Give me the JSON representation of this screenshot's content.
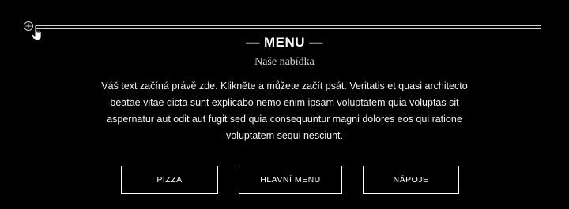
{
  "section": {
    "heading": "— MENU —",
    "subheading": "Naše nabídka",
    "body": "Váš text začíná právě zde. Klikněte a můžete začít psát. Veritatis et quasi architecto beatae vitae dicta sunt explicabo nemo enim ipsam voluptatem quia voluptas sit aspernatur aut odit aut fugit sed quia consequuntur magni dolores eos qui ratione voluptatem sequi nesciunt."
  },
  "buttons": [
    {
      "label": "PIZZA"
    },
    {
      "label": "HLAVNÍ MENU"
    },
    {
      "label": "NÁPOJE"
    }
  ],
  "icons": {
    "add_handle": "plus-circle-icon",
    "cursor": "hand-pointer-icon"
  },
  "colors": {
    "background": "#000000",
    "text": "#ffffff",
    "divider": "#cfcfcf"
  }
}
